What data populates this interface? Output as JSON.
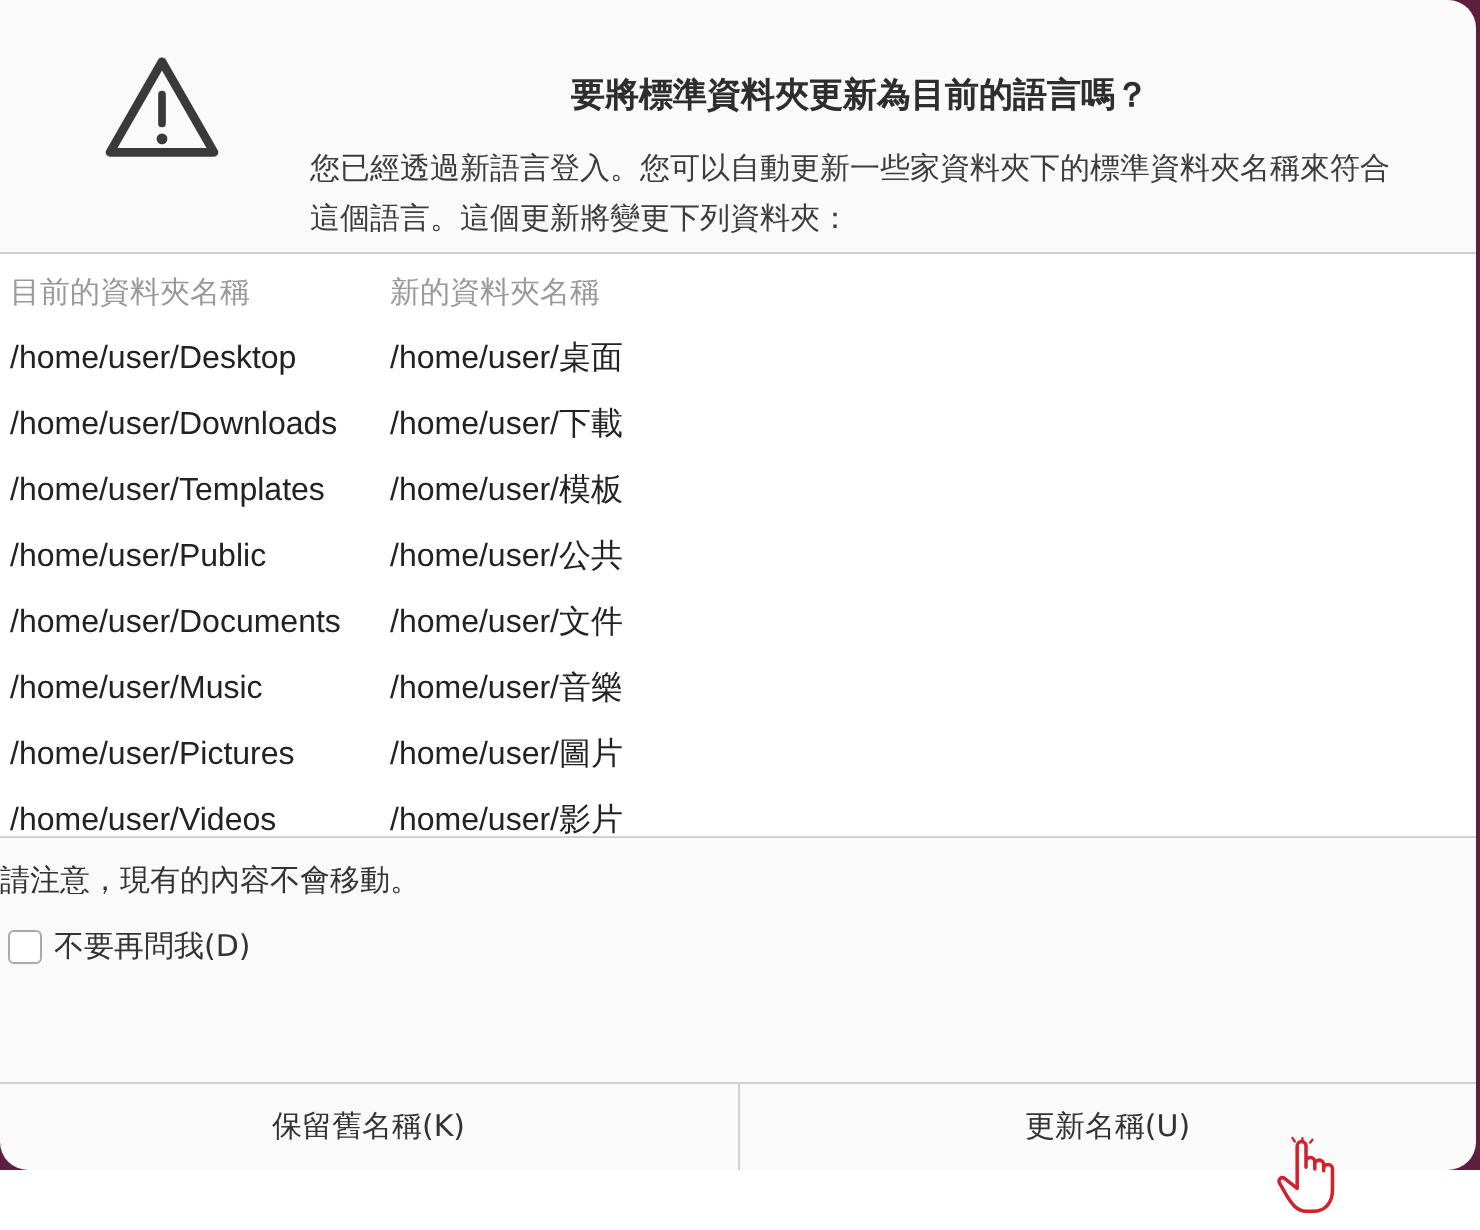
{
  "dialog": {
    "title": "要將標準資料夾更新為目前的語言嗎？",
    "message": "您已經透過新語言登入。您可以自動更新一些家資料夾下的標準資料夾名稱來符合這個語言。這個更新將變更下列資料夾："
  },
  "table": {
    "columns": [
      "目前的資料夾名稱",
      "新的資料夾名稱"
    ],
    "rows": [
      [
        "/home/user/Desktop",
        "/home/user/桌面"
      ],
      [
        "/home/user/Downloads",
        "/home/user/下載"
      ],
      [
        "/home/user/Templates",
        "/home/user/模板"
      ],
      [
        "/home/user/Public",
        "/home/user/公共"
      ],
      [
        "/home/user/Documents",
        "/home/user/文件"
      ],
      [
        "/home/user/Music",
        "/home/user/音樂"
      ],
      [
        "/home/user/Pictures",
        "/home/user/圖片"
      ],
      [
        "/home/user/Videos",
        "/home/user/影片"
      ]
    ]
  },
  "note": "請注意，現有的內容不會移動。",
  "checkbox": {
    "label": "不要再問我(D)",
    "checked": false
  },
  "buttons": [
    "保留舊名稱(K)",
    "更新名稱(U)"
  ]
}
